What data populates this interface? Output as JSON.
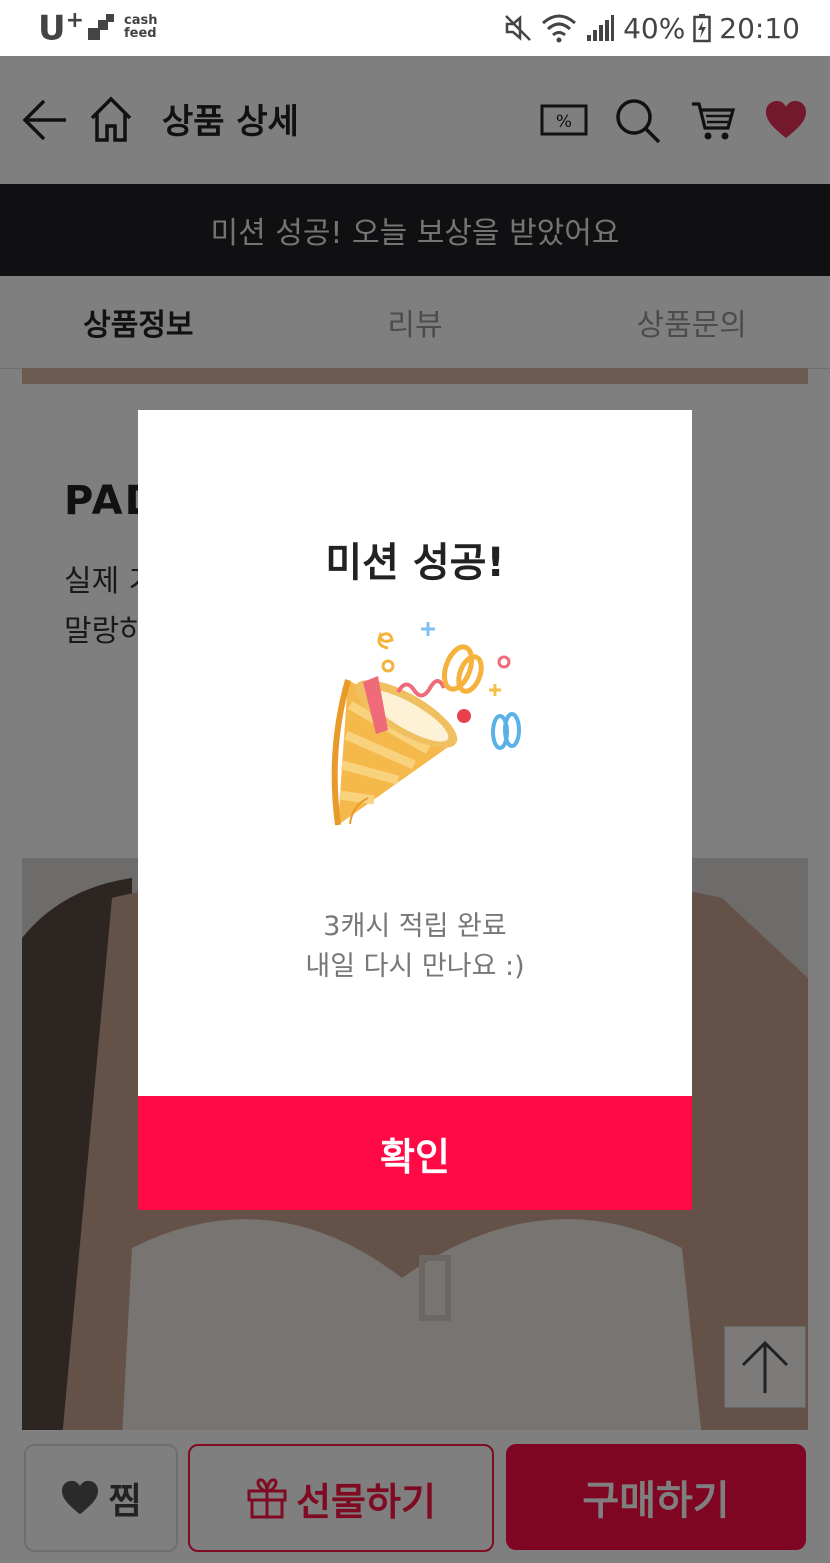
{
  "status_bar": {
    "carrier": "U",
    "carrier_plus": "+",
    "app_badge_line1": "cash",
    "app_badge_line2": "feed",
    "battery": "40%",
    "time": "20:10"
  },
  "header": {
    "title": "상품 상세",
    "back_icon": "arrow-left-icon",
    "home_icon": "home-icon",
    "coupon_icon": "percent-coupon-icon",
    "search_icon": "search-icon",
    "cart_icon": "cart-icon",
    "heart_icon": "heart-icon"
  },
  "banner": {
    "text": "미션 성공! 오늘 보상을 받았어요"
  },
  "tabs": [
    {
      "label": "상품정보"
    },
    {
      "label": "리뷰"
    },
    {
      "label": "상품문의"
    }
  ],
  "content": {
    "heading": "PAD",
    "desc_line1": "실제 가",
    "desc_line2": "말랑하"
  },
  "modal": {
    "title": "미션 성공!",
    "message_line1": "3캐시 적립 완료",
    "message_line2": "내일 다시 만나요 :)",
    "confirm_label": "확인"
  },
  "bottom_bar": {
    "wish_label": "찜",
    "gift_label": "선물하기",
    "buy_label": "구매하기"
  },
  "colors": {
    "accent": "#ff0a45",
    "banner_bg": "#202124",
    "heart": "#e8315b"
  }
}
